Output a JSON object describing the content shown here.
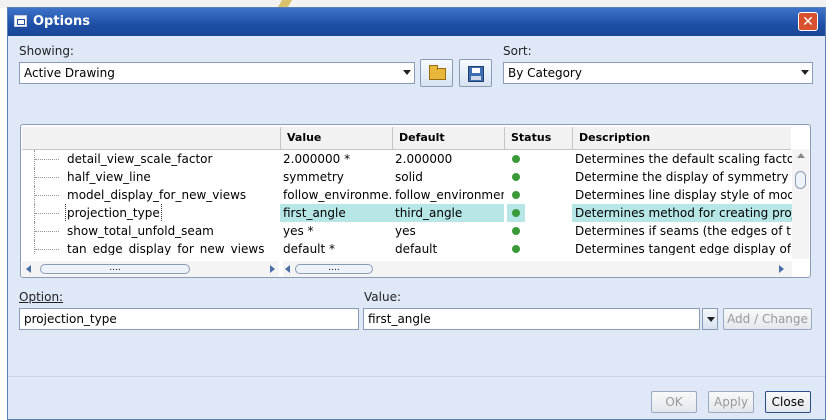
{
  "window": {
    "title": "Options"
  },
  "showing": {
    "label": "Showing:",
    "value": "Active Drawing"
  },
  "sort": {
    "label": "Sort:",
    "value": "By Category"
  },
  "icons": {
    "open": "open-folder-icon",
    "save": "save-icon",
    "close": "close-icon"
  },
  "table": {
    "columns": [
      "",
      "Value",
      "Default",
      "Status",
      "Description"
    ],
    "rows": [
      {
        "option": "detail_view_scale_factor",
        "value": "2.000000 *",
        "default": "2.000000",
        "status": "green",
        "description": "Determines the default scaling factor be"
      },
      {
        "option": "half_view_line",
        "value": "symmetry",
        "default": "solid",
        "status": "green",
        "description": "Determine the display of symmetry lines"
      },
      {
        "option": "model_display_for_new_views",
        "value": "follow_environme...",
        "default": "follow_environment",
        "status": "green",
        "description": "Determines line display style of model v"
      },
      {
        "option": "projection_type",
        "value": "first_angle",
        "default": "third_angle",
        "status": "green",
        "description": "Determines method for creating project",
        "selected": true
      },
      {
        "option": "show_total_unfold_seam",
        "value": "yes *",
        "default": "yes",
        "status": "green",
        "description": "Determines if seams (the edges of the"
      },
      {
        "option": "tan_edge_display_for_new_views",
        "value": "default *",
        "default": "default",
        "status": "green",
        "description": "Determines tangent edge display of mo"
      }
    ],
    "scroll_thumb": "....",
    "status_color": "#3a9a3a",
    "highlight_color": "#b7e6e6"
  },
  "option_field": {
    "label": "Option:",
    "value": "projection_type"
  },
  "value_field": {
    "label": "Value:",
    "value": "first_angle"
  },
  "buttons": {
    "add_change": "Add / Change",
    "ok": "OK",
    "apply": "Apply",
    "close": "Close"
  }
}
